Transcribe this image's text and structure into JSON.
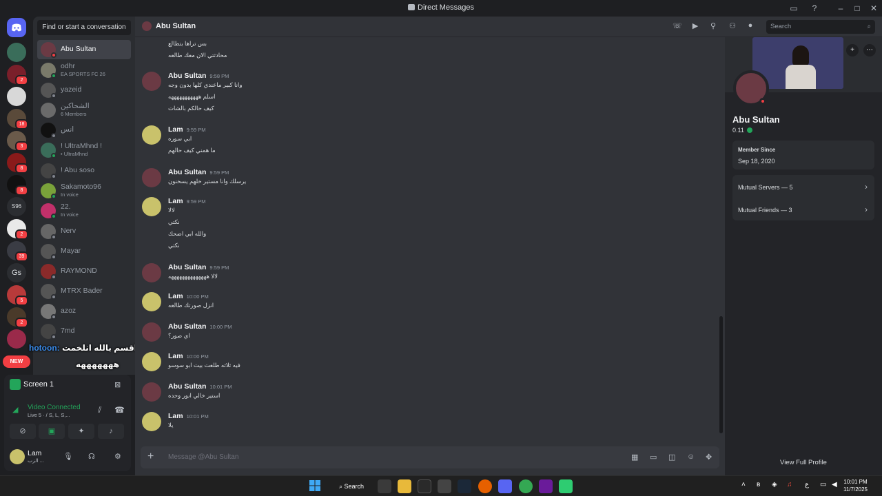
{
  "window": {
    "title": "Direct Messages"
  },
  "servers": [
    {
      "label": "",
      "badge": ""
    },
    {
      "label": "",
      "badge": "2"
    },
    {
      "label": "",
      "badge": ""
    },
    {
      "label": "",
      "badge": "18"
    },
    {
      "label": "",
      "badge": "3"
    },
    {
      "label": "",
      "badge": "8"
    },
    {
      "label": "",
      "badge": "8"
    },
    {
      "label": "S96",
      "badge": ""
    },
    {
      "label": "",
      "badge": "2"
    },
    {
      "label": "",
      "badge": "39"
    },
    {
      "label": "Gs",
      "badge": ""
    },
    {
      "label": "",
      "badge": "5"
    },
    {
      "label": "",
      "badge": "2"
    },
    {
      "label": "",
      "badge": ""
    }
  ],
  "new_pill": "NEW",
  "sidebar": {
    "find_label": "Find or start a conversation",
    "dms": [
      {
        "name": "Abu Sultan",
        "sub": "",
        "status": "dnd",
        "active": true
      },
      {
        "name": "odhr",
        "sub": "EA SPORTS FC 26",
        "status": "on"
      },
      {
        "name": "yazeid",
        "sub": "",
        "status": "off"
      },
      {
        "name": "الشحاكين",
        "sub": "6 Members",
        "status": ""
      },
      {
        "name": "انس",
        "sub": "",
        "status": "off"
      },
      {
        "name": "! UltraMhnd !",
        "sub": "• UltraMhnd",
        "status": "on"
      },
      {
        "name": "! Abu soso",
        "sub": "",
        "status": "off"
      },
      {
        "name": "Sakamoto96",
        "sub": "In voice",
        "status": "on"
      },
      {
        "name": "22.",
        "sub": "In voice",
        "status": "on"
      },
      {
        "name": "Nerv",
        "sub": "",
        "status": "off"
      },
      {
        "name": "Mayar",
        "sub": "",
        "status": "off"
      },
      {
        "name": "RAYMOND",
        "sub": "",
        "status": "off"
      },
      {
        "name": "MTRX Bader",
        "sub": "",
        "status": "off"
      },
      {
        "name": "azoz",
        "sub": "",
        "status": "off"
      },
      {
        "name": "7md",
        "sub": "",
        "status": "off"
      }
    ],
    "overlay_user": "hotoon:",
    "overlay_line1": "هو فيه فرق بالصوت بس اقسم بالله انلخمت",
    "overlay_line2": "هههههههه"
  },
  "voice": {
    "screen_label": "Screen 1",
    "status": "Video Connected",
    "sub": "Live 5 · / S, L, S,...",
    "user": "Lam",
    "user_sub": "الزب ..."
  },
  "header": {
    "name": "Abu Sultan",
    "search_placeholder": "Search"
  },
  "messages": [
    {
      "author": "",
      "time": "",
      "lines": [
        "بس تراها بتطالع",
        "محادثتي الان معك طالعه"
      ],
      "avatar": ""
    },
    {
      "author": "Abu Sultan",
      "time": "9:58 PM",
      "lines": [
        "وانا كبير ماعندي كلها بدون وجه",
        "اسلم هههههههههههه",
        "كيف حالكم بالشات"
      ],
      "avatar": "abu"
    },
    {
      "author": "Lam",
      "time": "9:59 PM",
      "lines": [
        "ابي سوره",
        "ما همني كيف حالهم"
      ],
      "avatar": "lam"
    },
    {
      "author": "Abu Sultan",
      "time": "9:59 PM",
      "lines": [
        "يرسلك وانا مستير خلهم يسخنون"
      ],
      "avatar": "abu"
    },
    {
      "author": "Lam",
      "time": "9:59 PM",
      "lines": [
        "لالا",
        "نكتي",
        "والله ابي اضحك",
        "نكتي"
      ],
      "avatar": "lam"
    },
    {
      "author": "Abu Sultan",
      "time": "9:59 PM",
      "lines": [
        "لالا ههههههههههههههه"
      ],
      "avatar": "abu"
    },
    {
      "author": "Lam",
      "time": "10:00 PM",
      "lines": [
        "انزل صورتك طالعه"
      ],
      "avatar": "lam"
    },
    {
      "author": "Abu Sultan",
      "time": "10:00 PM",
      "lines": [
        "اي صور؟"
      ],
      "avatar": "abu"
    },
    {
      "author": "Lam",
      "time": "10:00 PM",
      "lines": [
        "فيه ثلاثه طلعت بيت ابو سوسو"
      ],
      "avatar": "lam"
    },
    {
      "author": "Abu Sultan",
      "time": "10:01 PM",
      "lines": [
        "استير خالي انور وحده"
      ],
      "avatar": "abu"
    },
    {
      "author": "Lam",
      "time": "10:01 PM",
      "lines": [
        "يلا"
      ],
      "avatar": "lam"
    }
  ],
  "composer": {
    "placeholder": "Message @Abu Sultan"
  },
  "profile": {
    "name": "Abu Sultan",
    "tag": "0.11",
    "member_since_label": "Member Since",
    "member_since": "Sep 18, 2020",
    "mutual_servers": "Mutual Servers — 5",
    "mutual_friends": "Mutual Friends — 3",
    "view_full": "View Full Profile"
  },
  "taskbar": {
    "search": "Search",
    "time": "10:01 PM",
    "date": "11/7/2025",
    "lang": "ع"
  },
  "colors": {
    "accent": "#5865f2",
    "online": "#23a55a",
    "dnd": "#f23f43",
    "bg": "#313338"
  }
}
